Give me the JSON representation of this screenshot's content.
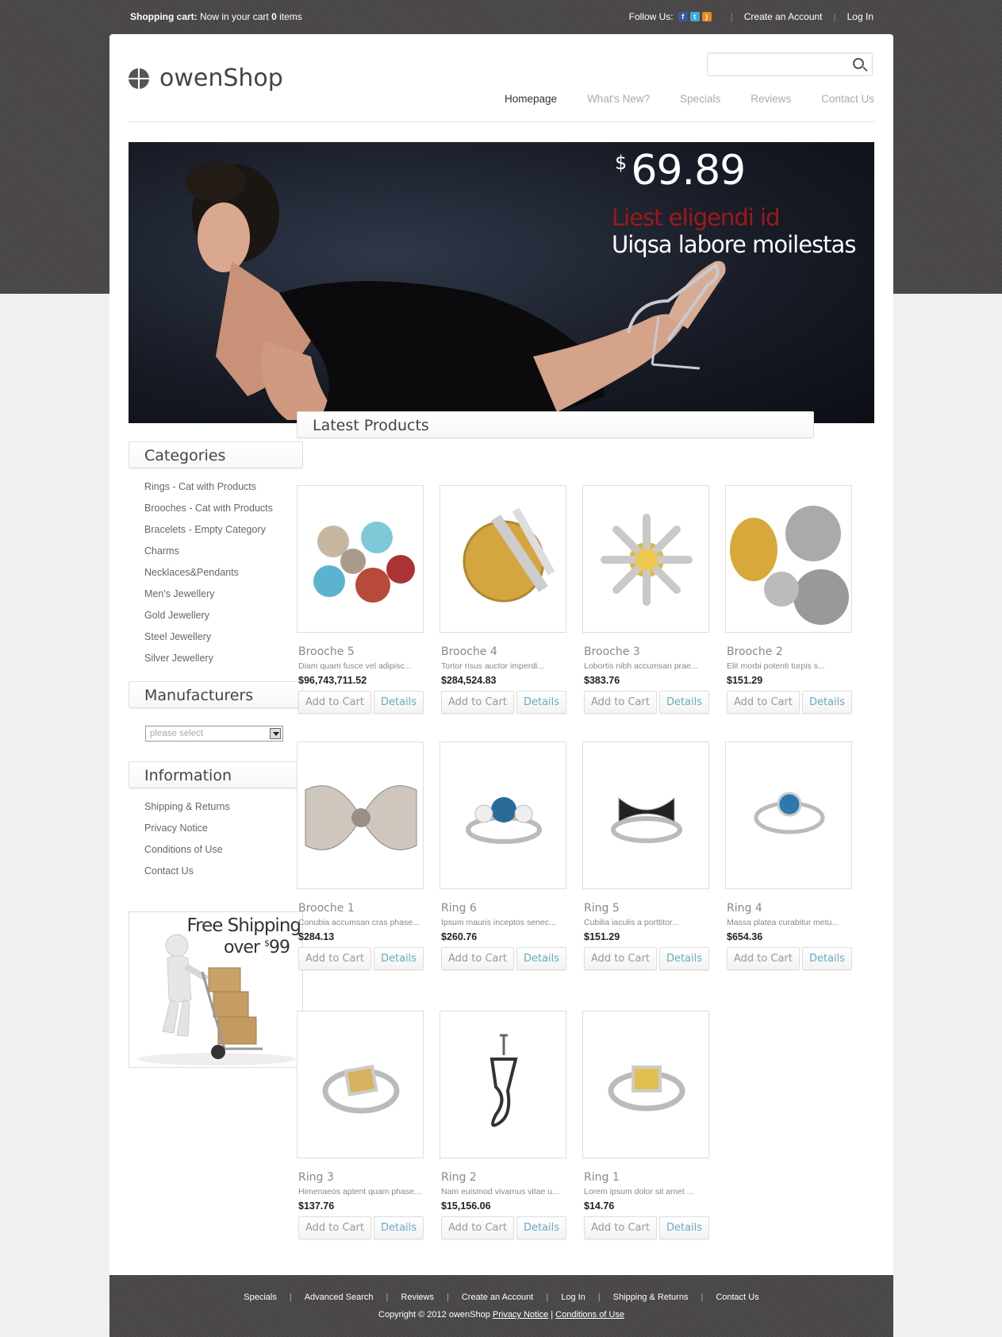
{
  "topbar": {
    "cart_label": "Shopping cart:",
    "cart_text": "Now in your cart",
    "cart_count": "0",
    "cart_suffix": "items",
    "follow_label": "Follow Us:",
    "create_account": "Create an Account",
    "login": "Log In",
    "social_icons": [
      "facebook-icon",
      "twitter-icon",
      "rss-icon"
    ]
  },
  "header": {
    "logo_text": "owenShop",
    "search_placeholder": "",
    "nav": [
      "Homepage",
      "What's New?",
      "Specials",
      "Reviews",
      "Contact Us"
    ]
  },
  "banner": {
    "currency": "$",
    "price": "69.89",
    "line1": "Liest eligendi id",
    "line2": "Uiqsa labore moilestas"
  },
  "sidebar": {
    "categories_title": "Categories",
    "categories": [
      "Rings - Cat with Products",
      "Brooches - Cat with Products",
      "Bracelets - Empty Category",
      "Charms",
      "Necklaces&Pendants",
      "Men's Jewellery",
      "Gold Jewellery",
      "Steel Jewellery",
      "Silver Jewellery"
    ],
    "manufacturers_title": "Manufacturers",
    "manufacturer_select": "please select",
    "information_title": "Information",
    "information": [
      "Shipping & Returns",
      "Privacy Notice",
      "Conditions of Use",
      "Contact Us"
    ],
    "promo_line1": "Free Shipping",
    "promo_line2": "over",
    "promo_currency": "$",
    "promo_amount": "99"
  },
  "main": {
    "title": "Latest Products",
    "add_to_cart": "Add to Cart",
    "details": "Details",
    "products": [
      {
        "name": "Brooche 5",
        "desc": "Diam quam fusce vel adipisc...",
        "price": "$96,743,711.52"
      },
      {
        "name": "Brooche 4",
        "desc": "Tortor risus auctor imperdi...",
        "price": "$284,524.83"
      },
      {
        "name": "Brooche 3",
        "desc": "Lobortis nibh accumsan prae...",
        "price": "$383.76"
      },
      {
        "name": "Brooche 2",
        "desc": "Elit morbi potenti turpis s...",
        "price": "$151.29"
      },
      {
        "name": "Brooche 1",
        "desc": "Conubia accumsan cras phase...",
        "price": "$284.13"
      },
      {
        "name": "Ring 6",
        "desc": "Ipsum mauris inceptos senec...",
        "price": "$260.76"
      },
      {
        "name": "Ring 5",
        "desc": "Cubilia iaculis a porttitor...",
        "price": "$151.29"
      },
      {
        "name": "Ring 4",
        "desc": "Massa platea curabitur metu...",
        "price": "$654.36"
      },
      {
        "name": "Ring 3",
        "desc": "Himenaeos aptent quam phase...",
        "price": "$137.76"
      },
      {
        "name": "Ring 2",
        "desc": "Nam euismod vivamus vitae u...",
        "price": "$15,156.06"
      },
      {
        "name": "Ring 1",
        "desc": "Lorem ipsum dolor sit amet ...",
        "price": "$14.76"
      }
    ]
  },
  "footer": {
    "links": [
      "Specials",
      "Advanced Search",
      "Reviews",
      "Create an Account",
      "Log In",
      "Shipping & Returns",
      "Contact Us"
    ],
    "copyright": "Copyright © 2012 owenShop",
    "privacy": "Privacy Notice",
    "conditions": "Conditions of Use"
  }
}
